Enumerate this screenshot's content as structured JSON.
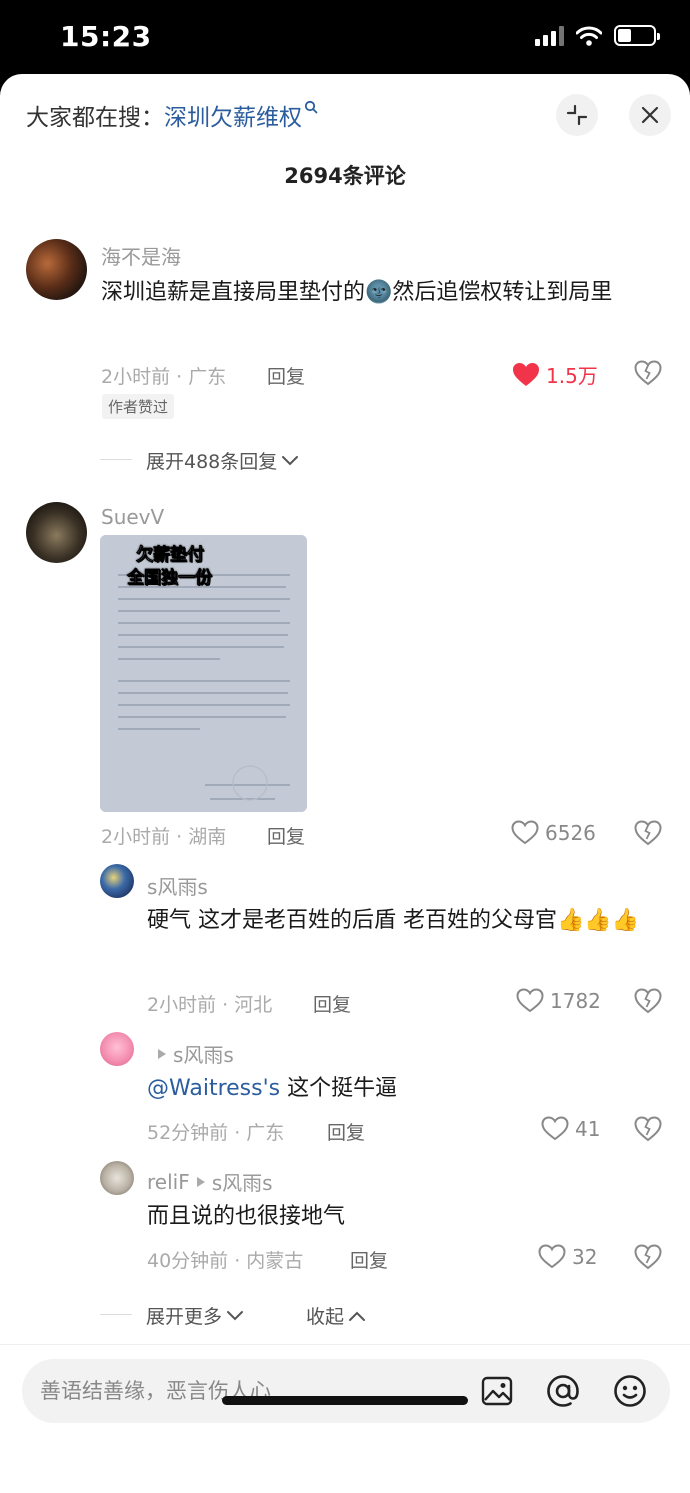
{
  "status_bar": {
    "time": "15:23"
  },
  "header": {
    "search_prefix": "大家都在搜：",
    "search_keyword": "深圳欠薪维权",
    "comment_count": "2694条评论"
  },
  "comments": [
    {
      "user": "海不是海",
      "text": "深圳追薪是直接局里垫付的🌚然后追偿权转让到局里",
      "time_location": "2小时前 · 广东",
      "reply_label": "回复",
      "likes": "1.5万",
      "liked": true,
      "badge": "作者赞过",
      "expand_label": "展开488条回复"
    },
    {
      "user": "SuevV",
      "image_overlay_line1": "欠薪垫付",
      "image_overlay_line2": "全国独一份",
      "time_location": "2小时前 · 湖南",
      "reply_label": "回复",
      "likes": "6526"
    }
  ],
  "replies": [
    {
      "user": "s风雨s",
      "text": "硬气 这才是老百姓的后盾 老百姓的父母官👍👍👍",
      "time_location": "2小时前 · 河北",
      "reply_label": "回复",
      "likes": "1782"
    },
    {
      "user": "s风雨s",
      "mention": "@Waitress's",
      "text": "这个挺牛逼",
      "time_location": "52分钟前 · 广东",
      "reply_label": "回复",
      "likes": "41"
    },
    {
      "user": "reliF",
      "reply_to": "s风雨s",
      "text": "而且说的也很接地气",
      "time_location": "40分钟前 · 内蒙古",
      "reply_label": "回复",
      "likes": "32"
    }
  ],
  "footer_actions": {
    "expand_more": "展开更多",
    "collapse": "收起"
  },
  "input": {
    "placeholder": "善语结善缘，恶言伤人心"
  },
  "colors": {
    "accent_link": "#2b5d9e",
    "like_red": "#f2344b"
  }
}
